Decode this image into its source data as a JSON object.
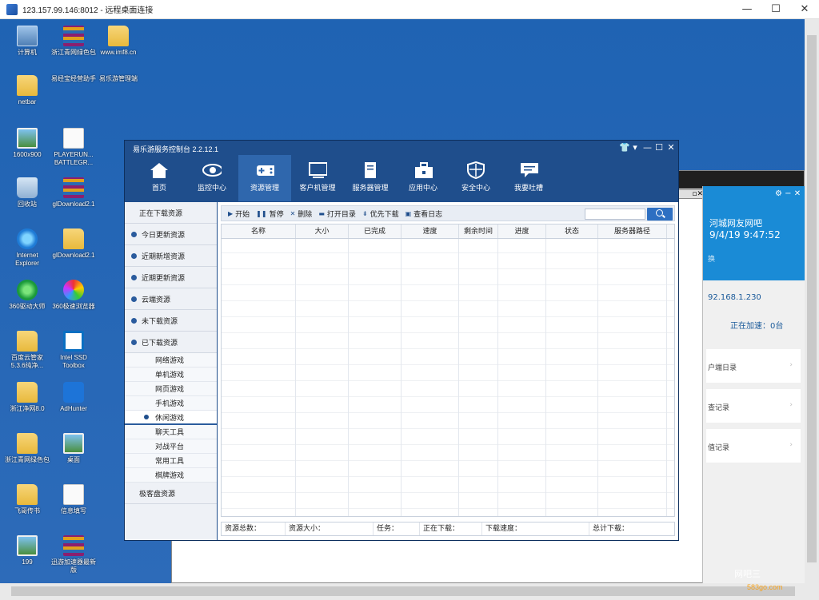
{
  "rdp": {
    "title": "123.157.99.146:8012 - 远程桌面连接",
    "minimize": "—",
    "maximize": "☐",
    "close": "✕"
  },
  "desktop_icons": [
    {
      "label": "计算机"
    },
    {
      "label": "浙江青网绿色包"
    },
    {
      "label": "www.imf8.cn"
    },
    {
      "label": "netbar"
    },
    {
      "label": "易经宝经营助手"
    },
    {
      "label": "易乐游管理端"
    },
    {
      "label": "1600x900"
    },
    {
      "label": "PLAYERUN... BATTLEGR..."
    },
    {
      "label": "回收站"
    },
    {
      "label": "glDownload2.1"
    },
    {
      "label": "Internet Explorer"
    },
    {
      "label": "glDownload2.1"
    },
    {
      "label": "360驱动大师"
    },
    {
      "label": "360极速浏览器"
    },
    {
      "label": "百度云管家5.3.6纯净..."
    },
    {
      "label": "Intel SSD Toolbox"
    },
    {
      "label": "浙江净网8.0"
    },
    {
      "label": "AdHunter"
    },
    {
      "label": "浙江青网绿色包"
    },
    {
      "label": "桌面"
    },
    {
      "label": "飞哥传书"
    },
    {
      "label": "信息填写"
    },
    {
      "label": "199"
    },
    {
      "label": "迅游加速器最新版"
    }
  ],
  "bg_window": {
    "line1": "河城网友网吧",
    "line2": "9/4/19 9:47:52",
    "line3": "换",
    "ip": "92.168.1.230",
    "accel": "正在加速：0台",
    "cards": [
      "户端日录",
      "查记录",
      "值记录"
    ],
    "controls": "⚙ − ✕",
    "brand": "网吧三",
    "brand_url": "583go.com"
  },
  "app": {
    "title": "易乐游服务控制台 2.2.12.1",
    "nav": [
      {
        "label": "首页"
      },
      {
        "label": "监控中心"
      },
      {
        "label": "资源管理"
      },
      {
        "label": "客户机管理"
      },
      {
        "label": "服务器管理"
      },
      {
        "label": "应用中心"
      },
      {
        "label": "安全中心"
      },
      {
        "label": "我要吐槽"
      }
    ],
    "sidebar": {
      "top": "正在下载资源",
      "items": [
        "今日更新资源",
        "近期新增资源",
        "近期更新资源",
        "云端资源",
        "未下载资源",
        "已下载资源"
      ],
      "subitems": [
        "网络游戏",
        "单机游戏",
        "网页游戏",
        "手机游戏",
        "休闲游戏",
        "聊天工具",
        "对战平台",
        "常用工具",
        "棋牌游戏"
      ],
      "bottom": "极客盘资源"
    },
    "toolbar": {
      "start": "开始",
      "pause": "暂停",
      "delete": "删除",
      "open_dir": "打开目录",
      "priority": "优先下载",
      "log": "查看日志",
      "search_placeholder": ""
    },
    "columns": [
      "名称",
      "大小",
      "已完成",
      "速度",
      "剩余时间",
      "进度",
      "状态",
      "服务器路径"
    ],
    "status": {
      "total": "资源总数：",
      "size": "资源大小：",
      "tasks": "任务：",
      "downloading": "正在下载：",
      "speed": "下载速度：",
      "total_dl": "总计下载："
    }
  }
}
